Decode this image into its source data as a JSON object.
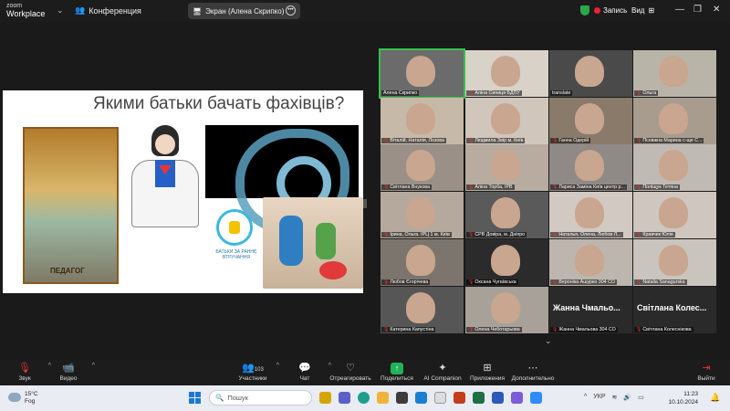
{
  "app": {
    "name_top": "zoom",
    "name_bottom": "Workplace",
    "meeting": "Конференция",
    "screen_label": "Экран (Алена Скрипко)",
    "record_label": "Запись",
    "view_label": "Вид"
  },
  "slide": {
    "title": "Якими батьки бачать фахівців?",
    "poster_caption": "ПЕДАГОГ",
    "logo_text": "БАТЬКИ ЗА РАННЄ ВТРУЧАННЯ"
  },
  "participants": [
    {
      "name": "Алена Скрипко",
      "muted": false,
      "active": true
    },
    {
      "name": "Аліна Синиця БДПУ",
      "muted": true
    },
    {
      "name": "translate",
      "muted": false
    },
    {
      "name": "Ольга",
      "muted": true
    },
    {
      "name": "Віталій, Наталія, Лозова",
      "muted": true
    },
    {
      "name": "Людмила Звір м. Київ",
      "muted": true
    },
    {
      "name": "Ганна Одерій",
      "muted": true
    },
    {
      "name": "Псевжна Марина с-ще С...",
      "muted": true
    },
    {
      "name": "Світлана Внукова",
      "muted": true
    },
    {
      "name": "Аліна Торба, ІРВ",
      "muted": true
    },
    {
      "name": "Лариса Заміна Київ центр р...",
      "muted": true
    },
    {
      "name": "Поліщук Тетяна",
      "muted": true
    },
    {
      "name": "Ірина, Ольга. ІРЦ 1 м. Київ",
      "muted": true
    },
    {
      "name": "СРВ Довіра, м. Дніпро",
      "muted": true
    },
    {
      "name": "Наталья, Олена, Любов Л...",
      "muted": true
    },
    {
      "name": "Кравчик Юлія",
      "muted": true
    },
    {
      "name": "Любов Єгорічева",
      "muted": true
    },
    {
      "name": "Оксана Чугаївська",
      "muted": true
    },
    {
      "name": "Вероніка Ашурко 304 СО",
      "muted": true
    },
    {
      "name": "Natalia Sanagurska",
      "muted": true
    },
    {
      "name": "Катерина Капустіна",
      "muted": true
    },
    {
      "name": "Олена Чеботарьова",
      "muted": true
    },
    {
      "name": "Жанна Чмальова 304 СО",
      "muted": true,
      "big": "Жанна Чмальо..."
    },
    {
      "name": "Світлана Колеснікова",
      "muted": true,
      "big": "Світлана Колес..."
    }
  ],
  "toolbar": {
    "audio": "Звук",
    "video": "Видео",
    "participants": "Участники",
    "participants_count": "103",
    "chat": "Чат",
    "react": "Отреагировать",
    "share": "Поделиться",
    "ai": "AI Companion",
    "apps": "Приложения",
    "more": "Дополнительно",
    "leave": "Выйти"
  },
  "taskbar": {
    "temp": "15°C",
    "weather": "Fog",
    "search": "Пошук",
    "lang": "УКР",
    "time": "11:23",
    "date": "10.10.2024"
  },
  "colors": {
    "accent": "#38c14e",
    "leave": "#e33333",
    "share": "#22b25a"
  }
}
